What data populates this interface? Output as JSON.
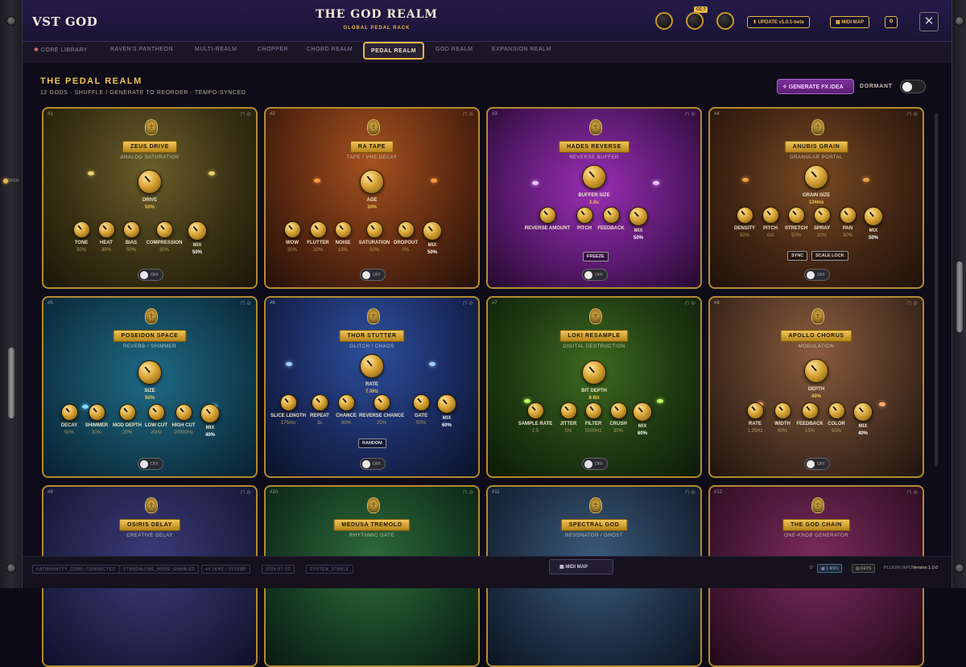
{
  "header": {
    "brand": "VST GOD",
    "title": "THE GOD REALM",
    "subtitle": "GLOBAL PEDAL RACK",
    "cc_badge": "CC 7",
    "update": "⬆ UPDATE v1.0.1-beta",
    "midi_map": "MIDI MAP",
    "settings": "⚙",
    "close": "✕"
  },
  "tabs": [
    "CORE LIBRARY",
    "RAVEN'S PANTHEON",
    "MULTI-REALM",
    "CHOPPER",
    "CHORD REALM",
    "PEDAL REALM",
    "GOD REALM",
    "EXPANSION REALM"
  ],
  "page": {
    "title": "THE PEDAL REALM",
    "subtitle": "12 GODS · SHUFFLE / GENERATE TO REORDER · TEMPO-SYNCED",
    "generate": "✧ GENERATE FX IDEA",
    "dormant": "DORMANT"
  },
  "power": "POWER",
  "off": "OFF",
  "pedals": [
    {
      "num": "#1",
      "name": "ZEUS DRIVE",
      "type": "ANALOG SATURATION",
      "big": {
        "label": "DRIVE",
        "value": "50%"
      },
      "knobs": [
        {
          "label": "TONE",
          "value": "50%"
        },
        {
          "label": "HEAT",
          "value": "30%"
        },
        {
          "label": "BIAS",
          "value": "50%"
        },
        {
          "label": "COMPRESSION",
          "value": "30%"
        },
        {
          "label": "MIX",
          "value": "50%"
        }
      ]
    },
    {
      "num": "#2",
      "name": "RA TAPE",
      "type": "TAPE / VHS DECAY",
      "big": {
        "label": "AGE",
        "value": "30%"
      },
      "knobs": [
        {
          "label": "WOW",
          "value": "30%"
        },
        {
          "label": "FLUTTER",
          "value": "30%"
        },
        {
          "label": "NOISE",
          "value": "15%"
        },
        {
          "label": "SATURATION",
          "value": "30%"
        },
        {
          "label": "DROPOUT",
          "value": "0%"
        },
        {
          "label": "MIX",
          "value": "50%"
        }
      ]
    },
    {
      "num": "#3",
      "name": "HADES REVERSE",
      "type": "REVERSE BUFFER",
      "big": {
        "label": "BUFFER SIZE",
        "value": "1.6s"
      },
      "knobs": [
        {
          "label": "REVERSE AMOUNT",
          "value": ""
        },
        {
          "label": "PITCH",
          "value": ""
        },
        {
          "label": "FEEDBACK",
          "value": ""
        },
        {
          "label": "MIX",
          "value": "50%"
        }
      ],
      "buttons": [
        "FREEZE"
      ]
    },
    {
      "num": "#4",
      "name": "ANUBIS GRAIN",
      "type": "GRANULAR PORTAL",
      "big": {
        "label": "GRAIN SIZE",
        "value": "134ms"
      },
      "knobs": [
        {
          "label": "DENSITY",
          "value": "50%"
        },
        {
          "label": "PITCH",
          "value": "0st"
        },
        {
          "label": "STRETCH",
          "value": "50%"
        },
        {
          "label": "SPRAY",
          "value": "20%"
        },
        {
          "label": "PAN",
          "value": "30%"
        },
        {
          "label": "MIX",
          "value": "50%"
        }
      ],
      "buttons": [
        "SYNC",
        "SCALE LOCK"
      ]
    },
    {
      "num": "#5",
      "name": "POSEIDON SPACE",
      "type": "REVERB / SHIMMER",
      "big": {
        "label": "SIZE",
        "value": "50%"
      },
      "knobs": [
        {
          "label": "DECAY",
          "value": "50%"
        },
        {
          "label": "SHIMMER",
          "value": "30%"
        },
        {
          "label": "MOD DEPTH",
          "value": "20%"
        },
        {
          "label": "LOW CUT",
          "value": "20Hz"
        },
        {
          "label": "HIGH CUT",
          "value": "20000Hz"
        },
        {
          "label": "MIX",
          "value": "40%"
        }
      ]
    },
    {
      "num": "#6",
      "name": "THOR STUTTER",
      "type": "GLITCH / CHAOS",
      "big": {
        "label": "RATE",
        "value": "7.0Hz"
      },
      "knobs": [
        {
          "label": "SLICE LENGTH",
          "value": "175ms"
        },
        {
          "label": "REPEAT",
          "value": "3x"
        },
        {
          "label": "CHANCE",
          "value": "60%"
        },
        {
          "label": "REVERSE CHANCE",
          "value": "20%"
        },
        {
          "label": "GATE",
          "value": "50%"
        },
        {
          "label": "MIX",
          "value": "60%"
        }
      ],
      "buttons": [
        "RANDOM"
      ]
    },
    {
      "num": "#7",
      "name": "LOKI RESAMPLE",
      "type": "DIGITAL DESTRUCTION",
      "big": {
        "label": "BIT DEPTH",
        "value": "8-Bit"
      },
      "knobs": [
        {
          "label": "SAMPLE RATE",
          "value": "1:5"
        },
        {
          "label": "JITTER",
          "value": "5%"
        },
        {
          "label": "FILTER",
          "value": "5000Hz"
        },
        {
          "label": "CRUSH",
          "value": "30%"
        },
        {
          "label": "MIX",
          "value": "60%"
        }
      ]
    },
    {
      "num": "#8",
      "name": "APOLLO CHORUS",
      "type": "MODULATION",
      "big": {
        "label": "DEPTH",
        "value": "40%"
      },
      "knobs": [
        {
          "label": "RATE",
          "value": "1.25Hz"
        },
        {
          "label": "WIDTH",
          "value": "60%"
        },
        {
          "label": "FEEDBACK",
          "value": "15%"
        },
        {
          "label": "COLOR",
          "value": "50%"
        },
        {
          "label": "MIX",
          "value": "40%"
        }
      ]
    },
    {
      "num": "#9",
      "name": "OSIRIS DELAY",
      "type": "CREATIVE DELAY"
    },
    {
      "num": "#10",
      "name": "MEDUSA TREMOLO",
      "type": "RHYTHMIC GATE"
    },
    {
      "num": "#11",
      "name": "SPECTRAL GOD",
      "type": "RESONATOR / GHOST"
    },
    {
      "num": "#12",
      "name": "THE GOD CHAIN",
      "type": "ONE-KNOB GENERATOR"
    }
  ],
  "footer": {
    "status": [
      "KATIBAHATTY_CORE::CONNECTED",
      "STANDALONE_MODE::ENABLED",
      "44.1KHZ / 512SMP",
      "2024-07-22",
      "SYSTEM_STABLE"
    ],
    "midi_map": "MIDI MAP",
    "midi_btn": "1 MIDI",
    "keys_btn": "KEYS",
    "plugin_info": "PLUGIN INFO",
    "version": "Version 1.0.0"
  },
  "colors": {
    "gold": "#e9b646",
    "frame": "#b48a2e",
    "accent_purple": "#7e2f9c"
  }
}
